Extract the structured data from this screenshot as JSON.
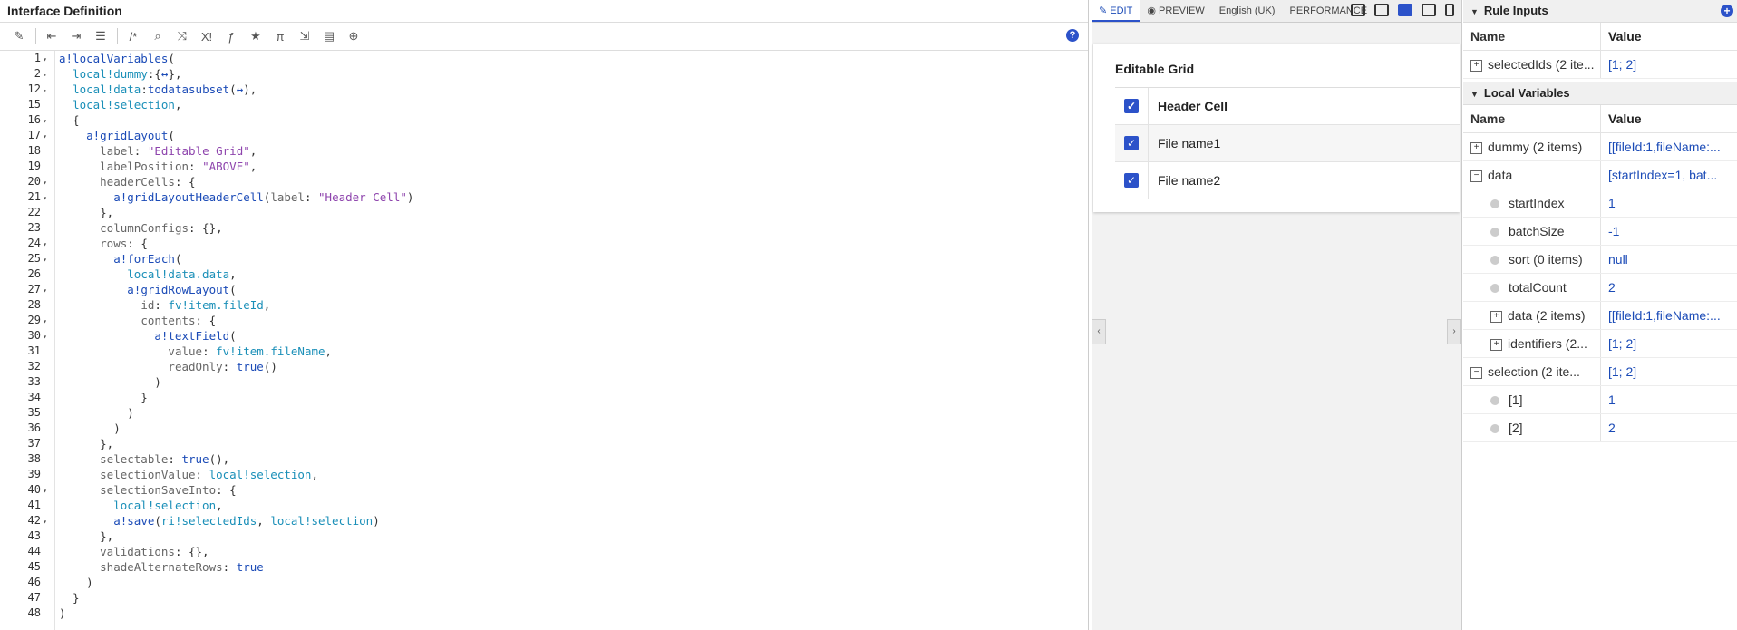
{
  "editor": {
    "title": "Interface Definition",
    "toolbar_icons": [
      "magic-wand-icon",
      "outdent-icon",
      "indent-icon",
      "list-icon",
      "comment-icon",
      "search-icon",
      "shuffle-icon",
      "x-exclaim-icon",
      "function-icon",
      "star-icon",
      "pi-icon",
      "export-icon",
      "search-doc-icon",
      "globe-icon"
    ],
    "help_label": "?",
    "lines": [
      {
        "n": "1",
        "fold": "▾",
        "html": "<span class='fn'>a!localVariables</span>("
      },
      {
        "n": "2",
        "fold": "▸",
        "html": "  <span class='var'>local!dummy</span>:{<span class='kw'>↔</span>},"
      },
      {
        "n": "12",
        "fold": "▸",
        "html": "  <span class='var'>local!data</span>:<span class='fn'>todatasubset</span>(<span class='kw'>↔</span>),"
      },
      {
        "n": "15",
        "fold": "",
        "html": "  <span class='var'>local!selection</span>,"
      },
      {
        "n": "16",
        "fold": "▾",
        "html": "  {"
      },
      {
        "n": "17",
        "fold": "▾",
        "html": "    <span class='fn'>a!gridLayout</span>("
      },
      {
        "n": "18",
        "fold": "",
        "html": "      <span class='prop'>label</span>: <span class='str'>\"Editable Grid\"</span>,"
      },
      {
        "n": "19",
        "fold": "",
        "html": "      <span class='prop'>labelPosition</span>: <span class='str'>\"ABOVE\"</span>,"
      },
      {
        "n": "20",
        "fold": "▾",
        "html": "      <span class='prop'>headerCells</span>: {"
      },
      {
        "n": "21",
        "fold": "▾",
        "html": "        <span class='fn'>a!gridLayoutHeaderCell</span>(<span class='prop'>label</span>: <span class='str'>\"Header Cell\"</span>)"
      },
      {
        "n": "22",
        "fold": "",
        "html": "      },"
      },
      {
        "n": "23",
        "fold": "",
        "html": "      <span class='prop'>columnConfigs</span>: {},"
      },
      {
        "n": "24",
        "fold": "▾",
        "html": "      <span class='prop'>rows</span>: {"
      },
      {
        "n": "25",
        "fold": "▾",
        "html": "        <span class='fn'>a!forEach</span>("
      },
      {
        "n": "26",
        "fold": "",
        "html": "          <span class='var'>local!data.data</span>,"
      },
      {
        "n": "27",
        "fold": "▾",
        "html": "          <span class='fn'>a!gridRowLayout</span>("
      },
      {
        "n": "28",
        "fold": "",
        "html": "            <span class='prop'>id</span>: <span class='var'>fv!item.fileId</span>,"
      },
      {
        "n": "29",
        "fold": "▾",
        "html": "            <span class='prop'>contents</span>: {"
      },
      {
        "n": "30",
        "fold": "▾",
        "html": "              <span class='fn'>a!textField</span>("
      },
      {
        "n": "31",
        "fold": "",
        "html": "                <span class='prop'>value</span>: <span class='var'>fv!item.fileName</span>,"
      },
      {
        "n": "32",
        "fold": "",
        "html": "                <span class='prop'>readOnly</span>: <span class='bool'>true</span>()"
      },
      {
        "n": "33",
        "fold": "",
        "html": "              )"
      },
      {
        "n": "34",
        "fold": "",
        "html": "            }"
      },
      {
        "n": "35",
        "fold": "",
        "html": "          )"
      },
      {
        "n": "36",
        "fold": "",
        "html": "        )"
      },
      {
        "n": "37",
        "fold": "",
        "html": "      },"
      },
      {
        "n": "38",
        "fold": "",
        "html": "      <span class='prop'>selectable</span>: <span class='bool'>true</span>(),"
      },
      {
        "n": "39",
        "fold": "",
        "html": "      <span class='prop'>selectionValue</span>: <span class='var'>local!selection</span>,"
      },
      {
        "n": "40",
        "fold": "▾",
        "html": "      <span class='prop'>selectionSaveInto</span>: {"
      },
      {
        "n": "41",
        "fold": "",
        "html": "        <span class='var'>local!selection</span>,"
      },
      {
        "n": "42",
        "fold": "▾",
        "html": "        <span class='fn'>a!save</span>(<span class='var'>ri!selectedIds</span>, <span class='var'>local!selection</span>)"
      },
      {
        "n": "43",
        "fold": "",
        "html": "      },"
      },
      {
        "n": "44",
        "fold": "",
        "html": "      <span class='prop'>validations</span>: {},"
      },
      {
        "n": "45",
        "fold": "",
        "html": "      <span class='prop'>shadeAlternateRows</span>: <span class='bool'>true</span>"
      },
      {
        "n": "46",
        "fold": "",
        "html": "    )"
      },
      {
        "n": "47",
        "fold": "",
        "html": "  }"
      },
      {
        "n": "48",
        "fold": "",
        "html": ")"
      }
    ]
  },
  "preview": {
    "tabs": {
      "edit": "EDIT",
      "preview": "PREVIEW",
      "locale": "English (UK)",
      "performance": "PERFORMANCE"
    },
    "devices": [
      "desktop-monitor-icon",
      "desktop-icon",
      "tablet-landscape-icon",
      "tablet-icon",
      "phone-icon"
    ],
    "grid_label": "Editable Grid",
    "rows": [
      "Header Cell",
      "File name1",
      "File name2"
    ],
    "check": "✓",
    "collapse_left": "‹",
    "collapse_right": "›"
  },
  "rule_inputs": {
    "title": "Rule Inputs",
    "col_name": "Name",
    "col_value": "Value",
    "rows": [
      {
        "name": "selectedIds (2 ite...",
        "value": "[1; 2]"
      }
    ]
  },
  "local_variables": {
    "title": "Local Variables",
    "col_name": "Name",
    "col_value": "Value",
    "rows": [
      {
        "name": "dummy (2 items)",
        "value": "[[fileId:1,fileName:...",
        "kind": "plus",
        "indent": 0
      },
      {
        "name": "data",
        "value": "[startIndex=1, bat...",
        "kind": "minus",
        "indent": 0
      },
      {
        "name": "startIndex",
        "value": "1",
        "kind": "dot",
        "indent": 1
      },
      {
        "name": "batchSize",
        "value": "-1",
        "kind": "dot",
        "indent": 1
      },
      {
        "name": "sort (0 items)",
        "value": "null",
        "kind": "dot",
        "indent": 1
      },
      {
        "name": "totalCount",
        "value": "2",
        "kind": "dot",
        "indent": 1
      },
      {
        "name": "data (2 items)",
        "value": "[[fileId:1,fileName:...",
        "kind": "plus",
        "indent": 1
      },
      {
        "name": "identifiers (2...",
        "value": "[1; 2]",
        "kind": "plus",
        "indent": 1
      },
      {
        "name": "selection (2 ite...",
        "value": "[1; 2]",
        "kind": "minus",
        "indent": 0
      },
      {
        "name": "[1]",
        "value": "1",
        "kind": "dot",
        "indent": 1
      },
      {
        "name": "[2]",
        "value": "2",
        "kind": "dot",
        "indent": 1
      }
    ]
  }
}
